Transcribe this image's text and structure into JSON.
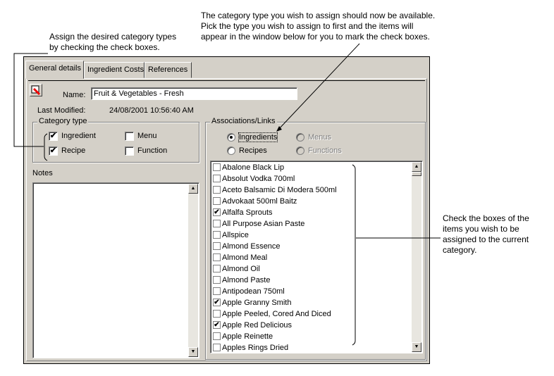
{
  "annotations": {
    "left": "Assign the desired category types\nby checking the check boxes.",
    "top": "The category type you wish to assign should now be available.\nPick the type you wish to assign to first and the items will\nappear in the window below for you to mark the check boxes.",
    "right": "Check the boxes of the\nitems you wish to be\nassigned to the current\ncategory."
  },
  "tabs": [
    {
      "label": "General details",
      "active": true
    },
    {
      "label": "Ingredient Costs"
    },
    {
      "label": "References"
    }
  ],
  "name_label": "Name:",
  "name_value": "Fruit & Vegetables - Fresh",
  "last_modified_label": "Last Modified:",
  "last_modified_value": "24/08/2001 10:56:40 AM",
  "category_type": {
    "title": "Category type",
    "items": [
      {
        "label": "Ingredient",
        "checked": true
      },
      {
        "label": "Menu",
        "checked": false
      },
      {
        "label": "Recipe",
        "checked": true
      },
      {
        "label": "Function",
        "checked": false
      }
    ]
  },
  "notes_label": "Notes",
  "associations": {
    "title": "Associations/Links",
    "radios": [
      {
        "label": "Ingredients",
        "selected": true,
        "enabled": true
      },
      {
        "label": "Menus",
        "enabled": false
      },
      {
        "label": "Recipes",
        "enabled": true
      },
      {
        "label": "Functions",
        "enabled": false
      }
    ],
    "items": [
      {
        "label": "Abalone Black Lip",
        "checked": false
      },
      {
        "label": "Absolut Vodka 700ml",
        "checked": false
      },
      {
        "label": "Aceto Balsamic Di Modera 500ml",
        "checked": false
      },
      {
        "label": "Advokaat 500ml Baitz",
        "checked": false
      },
      {
        "label": "Alfalfa Sprouts",
        "checked": true
      },
      {
        "label": "All Purpose Asian Paste",
        "checked": false
      },
      {
        "label": "Allspice",
        "checked": false
      },
      {
        "label": "Almond Essence",
        "checked": false
      },
      {
        "label": "Almond Meal",
        "checked": false
      },
      {
        "label": "Almond Oil",
        "checked": false
      },
      {
        "label": "Almond Paste",
        "checked": false
      },
      {
        "label": "Antipodean 750ml",
        "checked": false
      },
      {
        "label": "Apple Granny Smith",
        "checked": true
      },
      {
        "label": "Apple Peeled, Cored And Diced",
        "checked": false
      },
      {
        "label": "Apple Red Delicious",
        "checked": true
      },
      {
        "label": "Apple Reinette",
        "checked": false
      },
      {
        "label": "Apples Rings Dried",
        "checked": false
      }
    ]
  }
}
